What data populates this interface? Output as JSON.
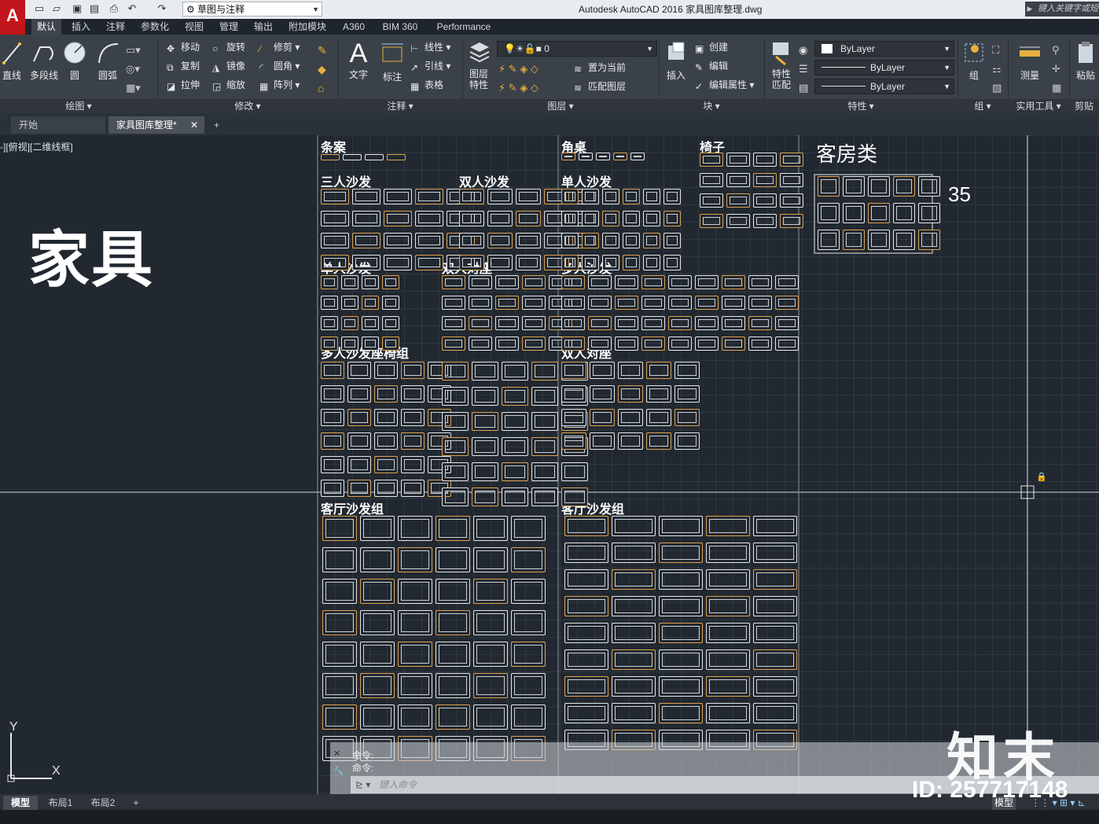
{
  "app": {
    "logo": "A",
    "workspace": "草图与注释",
    "title": "Autodesk AutoCAD 2016    家具图库整理.dwg",
    "search_placeholder": "键入关键字或短语"
  },
  "ribbon_tabs": [
    "默认",
    "插入",
    "注释",
    "参数化",
    "视图",
    "管理",
    "输出",
    "附加模块",
    "A360",
    "BIM 360",
    "Performance"
  ],
  "ribbon": {
    "draw": {
      "line": "直线",
      "polyline": "多段线",
      "circle": "圆",
      "arc": "圆弧",
      "panel": "绘图"
    },
    "modify": {
      "move": "移动",
      "rotate": "旋转",
      "trim": "修剪",
      "copy": "复制",
      "mirror": "镜像",
      "fillet": "圆角",
      "stretch": "拉伸",
      "scale": "缩放",
      "array": "阵列",
      "panel": "修改"
    },
    "annotation": {
      "text": "文字",
      "dimension": "标注",
      "linear": "线性",
      "leader": "引线",
      "table": "表格",
      "panel": "注释"
    },
    "layers": {
      "layer_props": "图层\n特性",
      "layer_value": "0",
      "set_current": "置为当前",
      "match_layer": "匹配图层",
      "panel": "图层"
    },
    "block": {
      "insert": "插入",
      "create": "创建",
      "edit": "编辑",
      "edit_attr": "编辑属性",
      "panel": "块"
    },
    "properties": {
      "match": "特性\n匹配",
      "color": "ByLayer",
      "linetype": "ByLayer",
      "lineweight": "ByLayer",
      "panel": "特性"
    },
    "groups": {
      "group": "组",
      "panel": "组"
    },
    "utilities": {
      "measure": "测量",
      "panel": "实用工具"
    },
    "clipboard": {
      "paste": "粘贴",
      "panel": "剪贴"
    }
  },
  "doc_tabs": [
    "开始",
    "家具图库整理*"
  ],
  "drawing": {
    "view_label": "-][俯视][二维线框]",
    "main_title": "家具",
    "sections": [
      "条案",
      "角桌",
      "椅子",
      "客房类",
      "三人沙发",
      "双人沙发",
      "单人沙发",
      "单人沙发",
      "双人对座",
      "多人沙发",
      "多人沙发座椅组",
      "双人对座",
      "客厅沙发组",
      "客厅沙发组"
    ],
    "count_label": "35",
    "axis_x": "X",
    "axis_y": "Y"
  },
  "command": {
    "history": [
      "命令:",
      "命令:"
    ],
    "placeholder": "键入命令"
  },
  "layout_tabs": [
    "模型",
    "布局1",
    "布局2"
  ],
  "status": {
    "model": "模型"
  },
  "watermark": {
    "brand": "知末",
    "id": "ID: 257717148"
  }
}
